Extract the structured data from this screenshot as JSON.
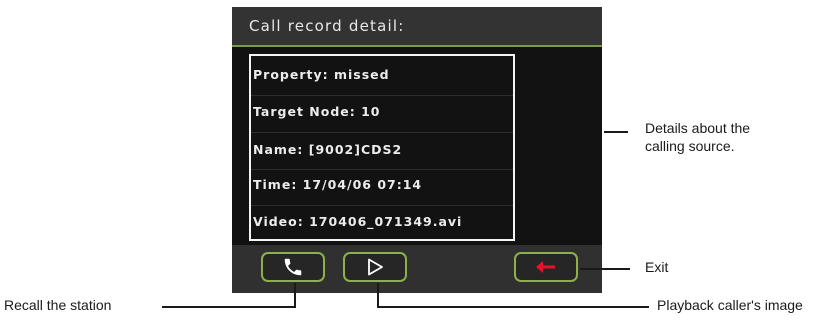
{
  "screen": {
    "title": "Call record detail:",
    "details": [
      "Property:  missed",
      "Target Node:  10",
      "Name:  [9002]CDS2",
      "Time:  17/04/06    07:14",
      "Video:  170406_071349.avi"
    ],
    "buttons": {
      "recall_icon": "phone-handset-icon",
      "playback_icon": "play-triangle-icon",
      "exit_icon": "left-arrow-icon"
    }
  },
  "callouts": {
    "details_line1": "Details about the",
    "details_line2": "calling source.",
    "exit": "Exit",
    "recall": "Recall the station",
    "playback": "Playback caller's image"
  },
  "colors": {
    "screen_background": "#121212",
    "bar_background": "#333333",
    "button_border": "#8db04a",
    "exit_arrow": "#e8112d",
    "text": "#ececec"
  }
}
